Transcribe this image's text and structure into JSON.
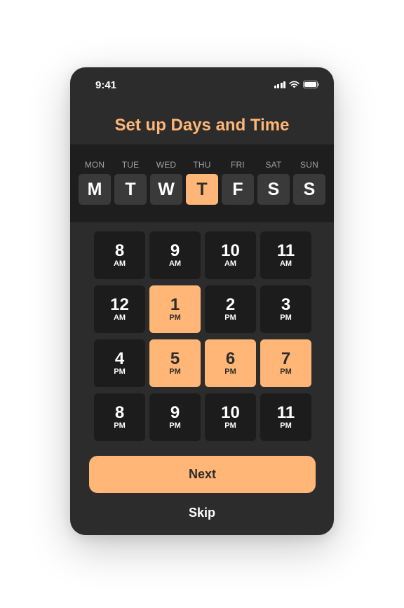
{
  "status_bar": {
    "time": "9:41",
    "icons": [
      "signal-icon",
      "wifi-icon",
      "battery-icon"
    ]
  },
  "title": "Set up Days and Time",
  "colors": {
    "accent": "#ffb676",
    "background": "#2c2c2c",
    "panel": "#1e1e1e",
    "tile": "#1c1c1c"
  },
  "days": [
    {
      "name": "MON",
      "letter": "M",
      "selected": false
    },
    {
      "name": "TUE",
      "letter": "T",
      "selected": false
    },
    {
      "name": "WED",
      "letter": "W",
      "selected": false
    },
    {
      "name": "THU",
      "letter": "T",
      "selected": true
    },
    {
      "name": "FRI",
      "letter": "F",
      "selected": false
    },
    {
      "name": "SAT",
      "letter": "S",
      "selected": false
    },
    {
      "name": "SUN",
      "letter": "S",
      "selected": false
    }
  ],
  "times": [
    {
      "hour": "8",
      "period": "AM",
      "selected": false
    },
    {
      "hour": "9",
      "period": "AM",
      "selected": false
    },
    {
      "hour": "10",
      "period": "AM",
      "selected": false
    },
    {
      "hour": "11",
      "period": "AM",
      "selected": false
    },
    {
      "hour": "12",
      "period": "AM",
      "selected": false
    },
    {
      "hour": "1",
      "period": "PM",
      "selected": true
    },
    {
      "hour": "2",
      "period": "PM",
      "selected": false
    },
    {
      "hour": "3",
      "period": "PM",
      "selected": false
    },
    {
      "hour": "4",
      "period": "PM",
      "selected": false
    },
    {
      "hour": "5",
      "period": "PM",
      "selected": true
    },
    {
      "hour": "6",
      "period": "PM",
      "selected": true
    },
    {
      "hour": "7",
      "period": "PM",
      "selected": true
    },
    {
      "hour": "8",
      "period": "PM",
      "selected": false
    },
    {
      "hour": "9",
      "period": "PM",
      "selected": false
    },
    {
      "hour": "10",
      "period": "PM",
      "selected": false
    },
    {
      "hour": "11",
      "period": "PM",
      "selected": false
    }
  ],
  "next_label": "Next",
  "skip_label": "Skip"
}
